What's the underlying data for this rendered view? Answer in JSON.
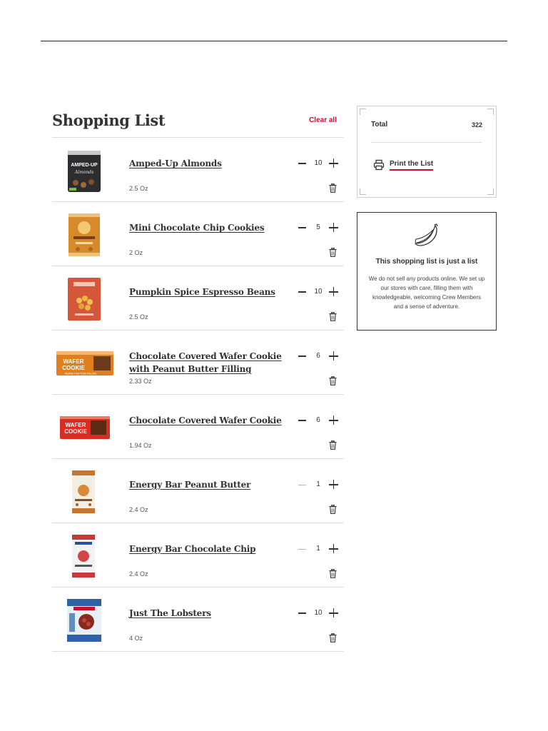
{
  "list": {
    "title": "Shopping List",
    "clear_all_label": "Clear all",
    "items": [
      {
        "name": "Amped-Up Almonds",
        "size": "2.5 Oz",
        "qty": "10",
        "thumb": "amped"
      },
      {
        "name": "Mini Chocolate Chip Cookies",
        "size": "2 Oz",
        "qty": "5",
        "thumb": "cookies"
      },
      {
        "name": "Pumpkin Spice Espresso Beans",
        "size": "2.5 Oz",
        "qty": "10",
        "thumb": "pumpkin"
      },
      {
        "name": "Chocolate Covered Wafer Cookie with Peanut Butter Filling",
        "size": "2.33 Oz",
        "qty": "6",
        "thumb": "wafer_pb"
      },
      {
        "name": "Chocolate Covered Wafer Cookie",
        "size": "1.94 Oz",
        "qty": "6",
        "thumb": "wafer"
      },
      {
        "name": "Energy Bar Peanut Butter",
        "size": "2.4 Oz",
        "qty": "1",
        "thumb": "energy_pb"
      },
      {
        "name": "Energy Bar Chocolate Chip",
        "size": "2.4 Oz",
        "qty": "1",
        "thumb": "energy_cc"
      },
      {
        "name": "Just The Lobsters",
        "size": "4 Oz",
        "qty": "10",
        "thumb": "lobsters"
      }
    ]
  },
  "summary": {
    "total_label": "Total",
    "total_value": "322",
    "print_label": "Print the List"
  },
  "info": {
    "title": "This shopping list is just a list",
    "body": "We do not sell any products online. We set up our stores with care, filling them with knowledgeable, welcoming Crew Members and a sense of adventure."
  },
  "thumb_labels": {
    "amped_top": "AMPED-UP",
    "amped_sub": "Almonds",
    "wafer": "WAFER",
    "cookie": "COOKIE",
    "pb_filling": "PEANUT BUTTER FILLING"
  },
  "icons": [
    "minus-icon",
    "plus-icon",
    "trash-icon",
    "printer-icon",
    "banana-icon"
  ],
  "colors": {
    "accent": "#c8102e",
    "text": "#333333",
    "rule": "#dcdcdc"
  }
}
